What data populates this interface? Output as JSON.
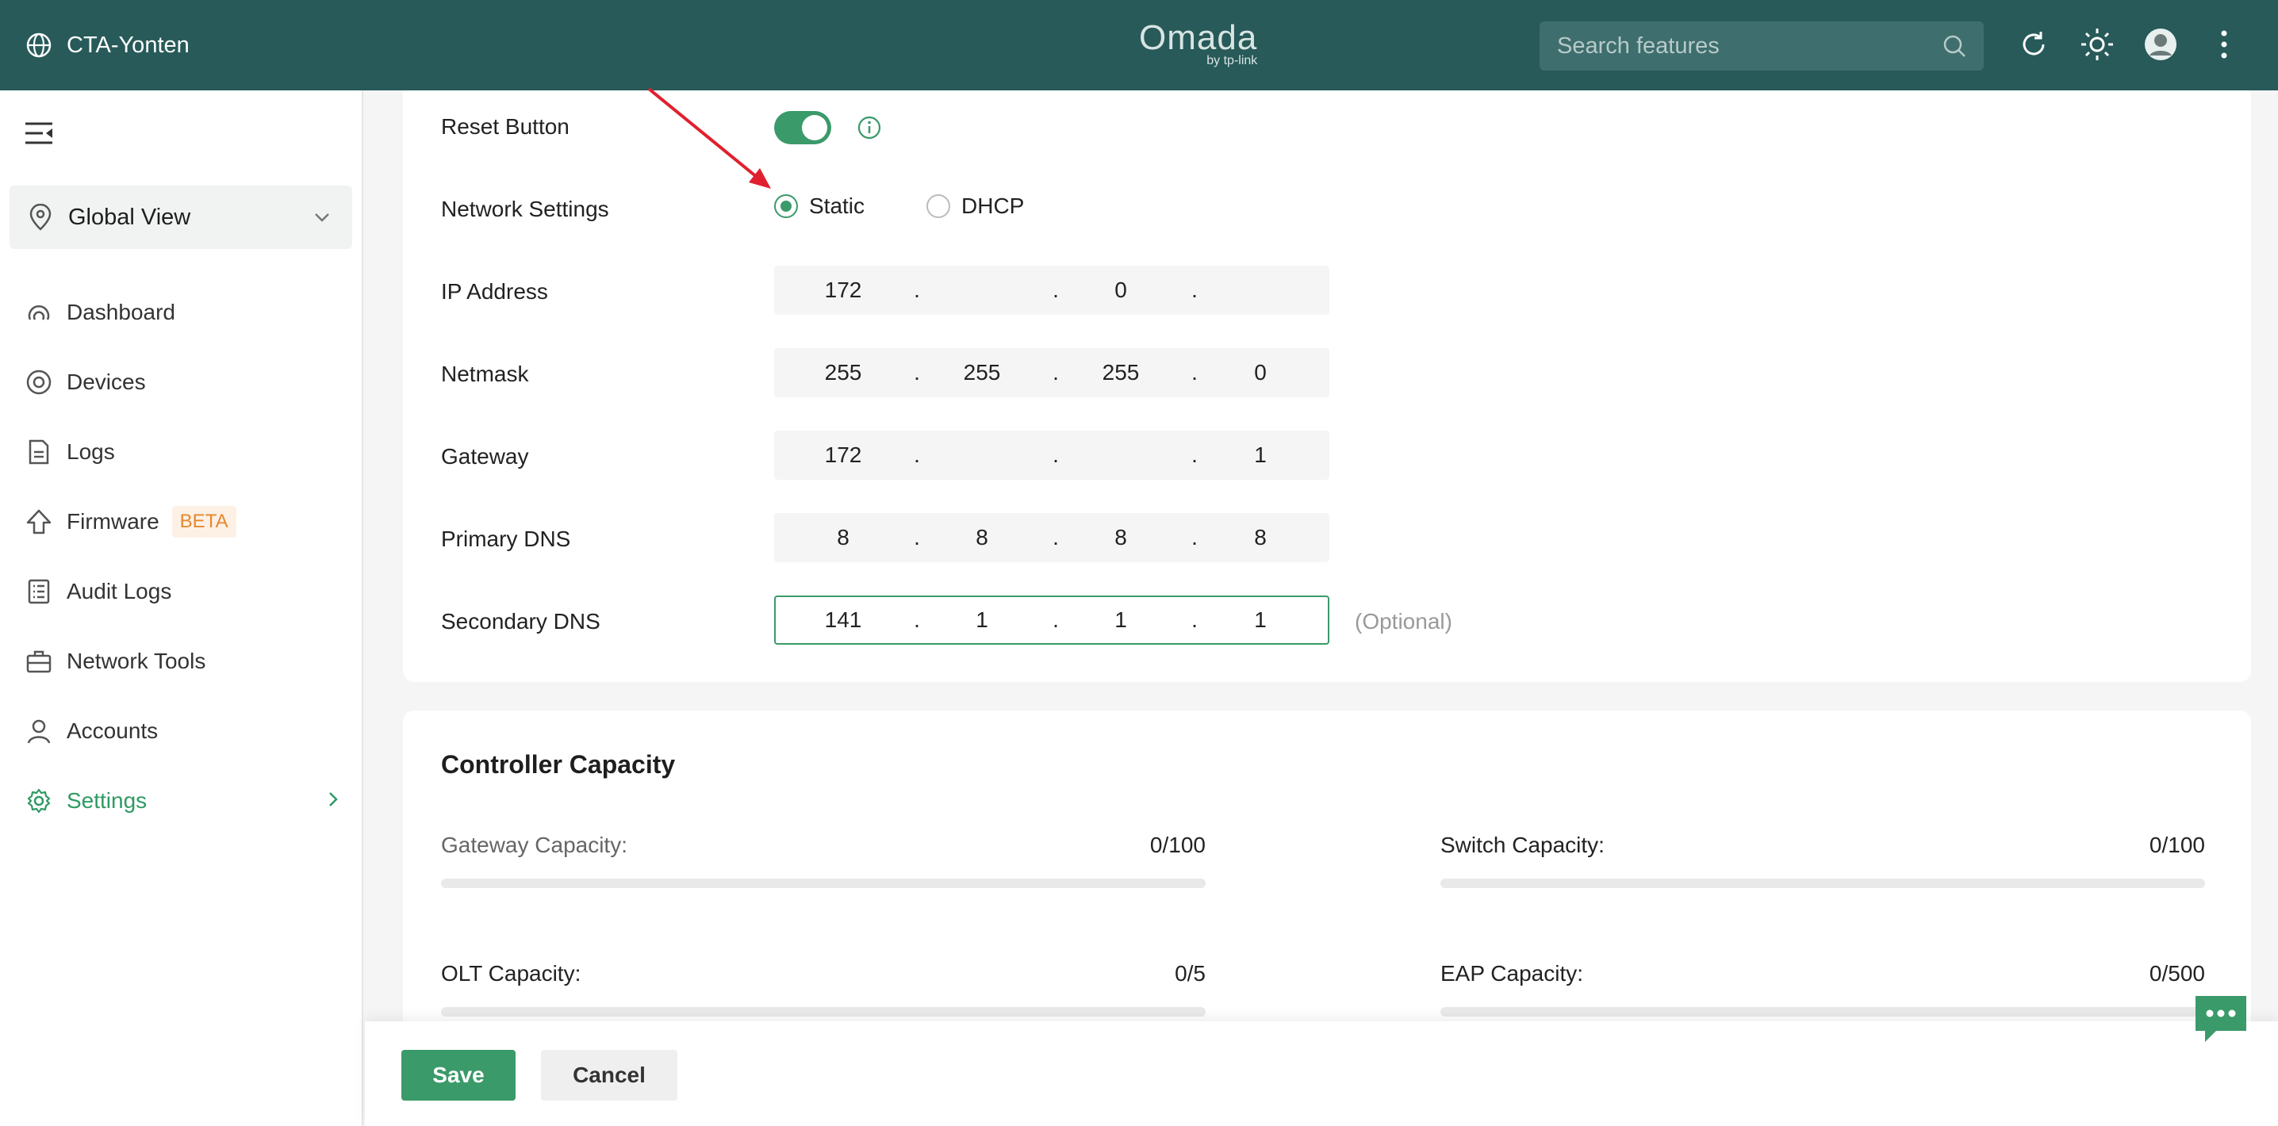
{
  "topbar": {
    "site_name": "CTA-Yonten",
    "logo_main": "Omada",
    "logo_sub": "by tp-link",
    "search_placeholder": "Search features"
  },
  "sidebar": {
    "site_selector": "Global View",
    "items": [
      {
        "label": "Dashboard",
        "icon": "dashboard-icon"
      },
      {
        "label": "Devices",
        "icon": "devices-icon"
      },
      {
        "label": "Logs",
        "icon": "logs-icon"
      },
      {
        "label": "Firmware",
        "icon": "firmware-icon",
        "badge": "BETA"
      },
      {
        "label": "Audit Logs",
        "icon": "audit-logs-icon"
      },
      {
        "label": "Network Tools",
        "icon": "network-tools-icon"
      },
      {
        "label": "Accounts",
        "icon": "accounts-icon"
      },
      {
        "label": "Settings",
        "icon": "settings-icon",
        "active": true
      }
    ]
  },
  "form": {
    "reset_button_label": "Reset Button",
    "reset_button_enabled": true,
    "network_settings_label": "Network Settings",
    "network_options": [
      "Static",
      "DHCP"
    ],
    "network_selected": "Static",
    "ip_address": {
      "label": "IP Address",
      "octets": [
        "172",
        "",
        "0",
        ""
      ]
    },
    "netmask": {
      "label": "Netmask",
      "octets": [
        "255",
        "255",
        "255",
        "0"
      ]
    },
    "gateway": {
      "label": "Gateway",
      "octets": [
        "172",
        "",
        "",
        "1"
      ]
    },
    "primary_dns": {
      "label": "Primary DNS",
      "octets": [
        "8",
        "8",
        "8",
        "8"
      ]
    },
    "secondary_dns": {
      "label": "Secondary DNS",
      "octets": [
        "141",
        "1",
        "1",
        "1"
      ],
      "hint": "(Optional)"
    }
  },
  "capacity": {
    "title": "Controller Capacity",
    "items": [
      {
        "label": "Gateway Capacity:",
        "value": "0/100",
        "used": 0
      },
      {
        "label": "Switch Capacity:",
        "value": "0/100",
        "used": 0
      },
      {
        "label": "OLT Capacity:",
        "value": "0/5",
        "used": 0
      },
      {
        "label": "EAP Capacity:",
        "value": "0/500",
        "used": 0
      }
    ]
  },
  "footer": {
    "save_label": "Save",
    "cancel_label": "Cancel"
  },
  "colors": {
    "topbar": "#275a59",
    "accent": "#3a9a69",
    "beta": "#e8872e",
    "annotation_arrow": "#e0202e"
  }
}
